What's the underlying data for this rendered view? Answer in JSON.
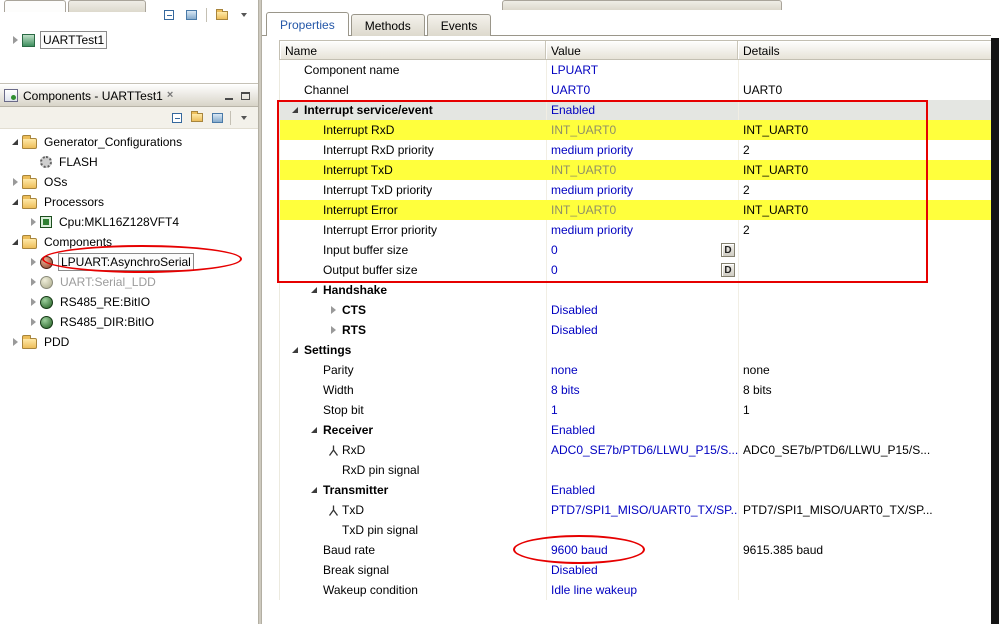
{
  "colors": {
    "value_link_blue": "#0000c0",
    "selected_tab_blue": "#2457a8",
    "highlight_yellow": "#ffff3c",
    "annotation_red": "#e60000",
    "selected_row_gray": "#e4e6e2"
  },
  "icons": {
    "close": "×",
    "mini_toolbar": [
      "collapse-all-icon",
      "stack-icon",
      "folder-icon",
      "view-menu-caret-icon"
    ],
    "components_toolbar": [
      "collapse-all-icon",
      "folder-icon",
      "stack-icon",
      "view-menu-caret-icon"
    ],
    "header_buttons": [
      "minimize-icon",
      "maximize-icon"
    ]
  },
  "left": {
    "mini": {
      "items": [
        {
          "label": "UARTTest1",
          "icon": "project",
          "expander": "collapsed"
        }
      ]
    },
    "components_view": {
      "title": "Components - UARTTest1",
      "tree": [
        {
          "label": "Generator_Configurations",
          "icon": "folder",
          "expander": "expanded",
          "level": 0
        },
        {
          "label": "FLASH",
          "icon": "gear",
          "expander": "none",
          "level": 1
        },
        {
          "label": "OSs",
          "icon": "folder",
          "expander": "collapsed",
          "level": 0
        },
        {
          "label": "Processors",
          "icon": "folder",
          "expander": "expanded",
          "level": 0
        },
        {
          "label": "Cpu:MKL16Z128VFT4",
          "icon": "chip",
          "expander": "collapsed",
          "level": 1
        },
        {
          "label": "Components",
          "icon": "folder",
          "expander": "expanded",
          "level": 0
        },
        {
          "label": "LPUART:AsynchroSerial",
          "icon": "bean-red",
          "expander": "collapsed",
          "level": 1,
          "selected": true
        },
        {
          "label": "UART:Serial_LDD",
          "icon": "bean-gray",
          "expander": "collapsed",
          "level": 1,
          "disabled": true
        },
        {
          "label": "RS485_RE:BitIO",
          "icon": "bean-green",
          "expander": "collapsed",
          "level": 1
        },
        {
          "label": "RS485_DIR:BitIO",
          "icon": "bean-green",
          "expander": "collapsed",
          "level": 1
        },
        {
          "label": "PDD",
          "icon": "folder",
          "expander": "collapsed",
          "level": 0
        }
      ]
    }
  },
  "inspector": {
    "tabs": [
      {
        "label": "Properties",
        "selected": true
      },
      {
        "label": "Methods",
        "selected": false
      },
      {
        "label": "Events",
        "selected": false
      }
    ],
    "columns": [
      "Name",
      "Value",
      "Details"
    ],
    "d_button_label": "D",
    "rows": [
      {
        "name": "Component name",
        "value": "LPUART",
        "details": "",
        "level": 0,
        "value_style": "link"
      },
      {
        "name": "Channel",
        "value": "UART0",
        "details": "UART0",
        "level": 0,
        "value_style": "link"
      },
      {
        "name": "Interrupt service/event",
        "value": "Enabled",
        "details": "",
        "level": 0,
        "expander": "expanded",
        "bold": true,
        "selected": true,
        "value_style": "link"
      },
      {
        "name": "Interrupt RxD",
        "value": "INT_UART0",
        "details": "INT_UART0",
        "level": 1,
        "row_bg": "yellow",
        "value_style": "muted"
      },
      {
        "name": "Interrupt RxD priority",
        "value": "medium priority",
        "details": "2",
        "level": 1,
        "value_style": "link"
      },
      {
        "name": "Interrupt TxD",
        "value": "INT_UART0",
        "details": "INT_UART0",
        "level": 1,
        "row_bg": "yellow",
        "value_style": "muted"
      },
      {
        "name": "Interrupt TxD priority",
        "value": "medium priority",
        "details": "2",
        "level": 1,
        "value_style": "link"
      },
      {
        "name": "Interrupt Error",
        "value": "INT_UART0",
        "details": "INT_UART0",
        "level": 1,
        "row_bg": "yellow",
        "value_style": "muted"
      },
      {
        "name": "Interrupt Error priority",
        "value": "medium priority",
        "details": "2",
        "level": 1,
        "value_style": "link"
      },
      {
        "name": "Input buffer size",
        "value": "0",
        "details": "",
        "level": 1,
        "value_style": "link",
        "d_button": true
      },
      {
        "name": "Output buffer size",
        "value": "0",
        "details": "",
        "level": 1,
        "value_style": "link",
        "d_button": true
      },
      {
        "name": "Handshake",
        "value": "",
        "details": "",
        "level": 1,
        "expander": "expanded",
        "bold": true
      },
      {
        "name": "CTS",
        "value": "Disabled",
        "details": "",
        "level": 2,
        "expander": "collapsed",
        "bold": true,
        "value_style": "link"
      },
      {
        "name": "RTS",
        "value": "Disabled",
        "details": "",
        "level": 2,
        "expander": "collapsed",
        "bold": true,
        "value_style": "link"
      },
      {
        "name": "Settings",
        "value": "",
        "details": "",
        "level": 0,
        "expander": "expanded",
        "bold": true
      },
      {
        "name": "Parity",
        "value": "none",
        "details": "none",
        "level": 1,
        "value_style": "link"
      },
      {
        "name": "Width",
        "value": "8 bits",
        "details": "8 bits",
        "level": 1,
        "value_style": "link"
      },
      {
        "name": "Stop bit",
        "value": "1",
        "details": "1",
        "level": 1,
        "value_style": "link"
      },
      {
        "name": "Receiver",
        "value": "Enabled",
        "details": "",
        "level": 1,
        "expander": "expanded",
        "bold": true,
        "value_style": "link"
      },
      {
        "name": "RxD",
        "value": "ADC0_SE7b/PTD6/LLWU_P15/S...",
        "details": "ADC0_SE7b/PTD6/LLWU_P15/S...",
        "level": 2,
        "icon": "pin",
        "value_style": "link"
      },
      {
        "name": "RxD pin signal",
        "value": "",
        "details": "",
        "level": 2
      },
      {
        "name": "Transmitter",
        "value": "Enabled",
        "details": "",
        "level": 1,
        "expander": "expanded",
        "bold": true,
        "value_style": "link"
      },
      {
        "name": "TxD",
        "value": "PTD7/SPI1_MISO/UART0_TX/SP...",
        "details": "PTD7/SPI1_MISO/UART0_TX/SP...",
        "level": 2,
        "icon": "pin",
        "value_style": "link"
      },
      {
        "name": "TxD pin signal",
        "value": "",
        "details": "",
        "level": 2
      },
      {
        "name": "Baud rate",
        "value": "9600 baud",
        "details": "9615.385 baud",
        "level": 1,
        "value_style": "link",
        "annotated": "ellipse"
      },
      {
        "name": "Break signal",
        "value": "Disabled",
        "details": "",
        "level": 1,
        "value_style": "link"
      },
      {
        "name": "Wakeup condition",
        "value": "Idle line wakeup",
        "details": "",
        "level": 1,
        "value_style": "link"
      }
    ]
  }
}
